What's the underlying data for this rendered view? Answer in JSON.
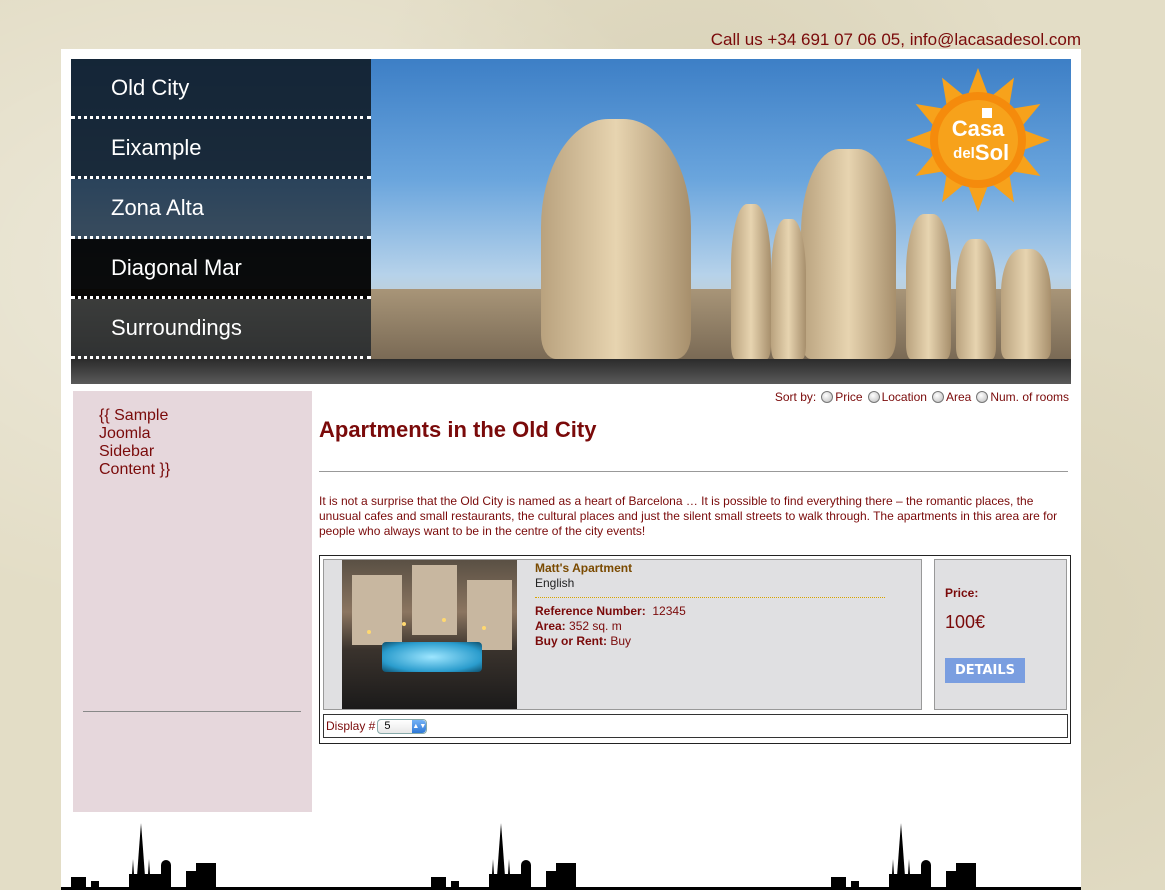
{
  "contact": "Call us +34 691 07 06 05, info@lacasadesol.com",
  "menu": [
    {
      "label": "Old City"
    },
    {
      "label": "Eixample"
    },
    {
      "label": "Zona Alta"
    },
    {
      "label": "Diagonal Mar"
    },
    {
      "label": "Surroundings"
    }
  ],
  "logo": {
    "line1": "Casa",
    "line2": "del",
    "line3": "Sol",
    "color": "#f39a12"
  },
  "sidebar": {
    "text": "{{ Sample Joomla Sidebar Content }}"
  },
  "sort": {
    "label": "Sort by:",
    "options": [
      "Price",
      "Location",
      "Area",
      "Num. of rooms"
    ]
  },
  "main": {
    "title": "Apartments in the Old City",
    "intro": "It is not a surprise that the Old City is named as a heart of Barcelona … It is possible to find everything there – the romantic places, the unusual cafes and small restaurants, the cultural places and just the silent small streets to walk through. The apartments in this area are for people who always want to be in the centre of the city events!"
  },
  "listing": {
    "name": "Matt's Apartment",
    "language": "English",
    "ref_label": "Reference Number:",
    "ref_value": "12345",
    "area_label": "Area:",
    "area_value": "352  sq. m",
    "type_label": "Buy or Rent:",
    "type_value": "Buy",
    "price_label": "Price:",
    "price_value": "100€",
    "details_label": "DETAILS"
  },
  "pagination": {
    "display_label": "Display #",
    "display_value": "5"
  },
  "colors": {
    "accent": "#7a0a0a",
    "button": "#7a9ee0",
    "sidebar_bg": "#e6d7dc"
  }
}
